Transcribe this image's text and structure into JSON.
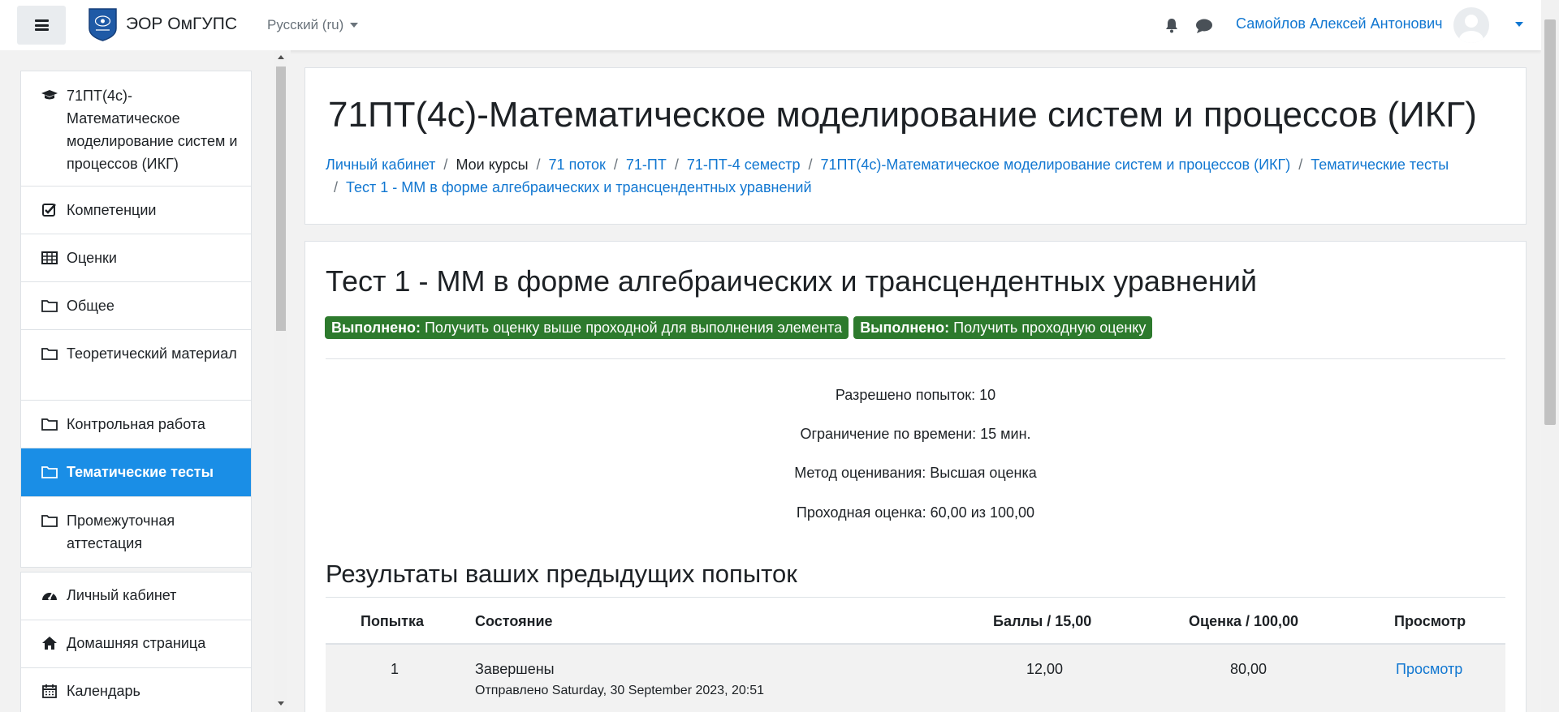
{
  "navbar": {
    "site_name": "ЭОР ОмГУПС",
    "language": "Русский (ru)",
    "user_name": "Самойлов Алексей Антонович"
  },
  "drawer": {
    "course_items": [
      {
        "label": "71ПТ(4с)-Математическое моделирование систем и процессов (ИКГ)",
        "icon": "graduation-cap-icon"
      },
      {
        "label": "Компетенции",
        "icon": "check-square-icon"
      },
      {
        "label": "Оценки",
        "icon": "table-icon"
      },
      {
        "label": "Общее",
        "icon": "folder-icon"
      },
      {
        "label": "Теоретический материал",
        "icon": "folder-icon"
      },
      {
        "label": "Контрольная работа",
        "icon": "folder-icon"
      },
      {
        "label": "Тематические тесты",
        "icon": "folder-icon",
        "active": true
      },
      {
        "label": "Промежуточная аттестация",
        "icon": "folder-icon"
      }
    ],
    "site_items": [
      {
        "label": "Личный кабинет",
        "icon": "dashboard-icon"
      },
      {
        "label": "Домашняя страница",
        "icon": "home-icon"
      },
      {
        "label": "Календарь",
        "icon": "calendar-icon"
      }
    ]
  },
  "header": {
    "course_title": "71ПТ(4с)-Математическое моделирование систем и процессов (ИКГ)",
    "breadcrumb": [
      {
        "label": "Личный кабинет",
        "link": true
      },
      {
        "label": "Мои курсы",
        "link": false
      },
      {
        "label": "71 поток",
        "link": true
      },
      {
        "label": "71-ПТ",
        "link": true
      },
      {
        "label": "71-ПТ-4 семестр",
        "link": true
      },
      {
        "label": "71ПТ(4с)-Математическое моделирование систем и процессов (ИКГ)",
        "link": true
      },
      {
        "label": "Тематические тесты",
        "link": true
      },
      {
        "label": "Тест 1 - ММ в форме алгебраических и трансцендентных уравнений",
        "link": true
      }
    ]
  },
  "activity": {
    "title": "Тест 1 - ММ в форме алгебраических и трансцендентных уравнений",
    "completion": [
      {
        "status": "Выполнено:",
        "text": "Получить оценку выше проходной для выполнения элемента"
      },
      {
        "status": "Выполнено:",
        "text": "Получить проходную оценку"
      }
    ],
    "info": [
      "Разрешено попыток: 10",
      "Ограничение по времени: 15 мин.",
      "Метод оценивания: Высшая оценка",
      "Проходная оценка: 60,00 из 100,00"
    ],
    "results_title": "Результаты ваших предыдущих попыток",
    "table": {
      "headers": [
        "Попытка",
        "Состояние",
        "Баллы / 15,00",
        "Оценка / 100,00",
        "Просмотр"
      ],
      "rows": [
        {
          "attempt": "1",
          "state": "Завершены",
          "submitted": "Отправлено Saturday, 30 September 2023, 20:51",
          "points": "12,00",
          "grade": "80,00",
          "review": "Просмотр"
        }
      ]
    }
  },
  "colors": {
    "accent": "#1177d1",
    "active_item": "#1a8ee6",
    "success_badge": "#2d7a2d"
  }
}
